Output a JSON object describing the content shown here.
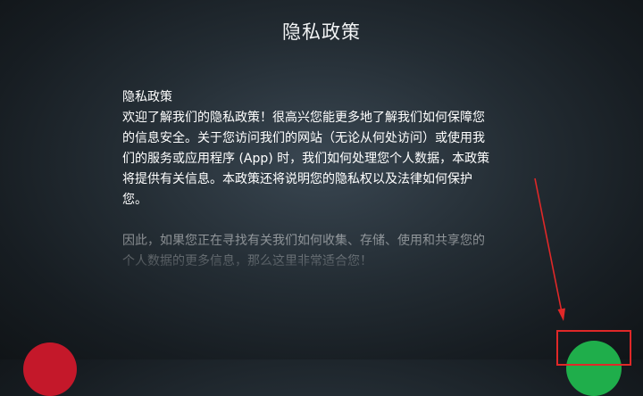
{
  "header": {
    "title": "隐私政策"
  },
  "policy": {
    "heading": "隐私政策",
    "lines": [
      "欢迎了解我们的隐私政策！很高兴您能更多地了解我们如何保障您",
      "的信息安全。关于您访问我们的网站（无论从何处访问）或使用我",
      "们的服务或应用程序 (App) 时，我们如何处理您个人数据，本政策",
      "将提供有关信息。本政策还将说明您的隐私权以及法律如何保护",
      "您。"
    ],
    "faded_lines": [
      "因此，如果您正在寻找有关我们如何收集、存储、使用和共享您的",
      "个人数据的更多信息，那么这里非常适合您！"
    ]
  },
  "actions": {
    "decline_color": "#c4182a",
    "accept_color": "#1fae4b"
  },
  "annotation": {
    "color": "#e02828"
  }
}
